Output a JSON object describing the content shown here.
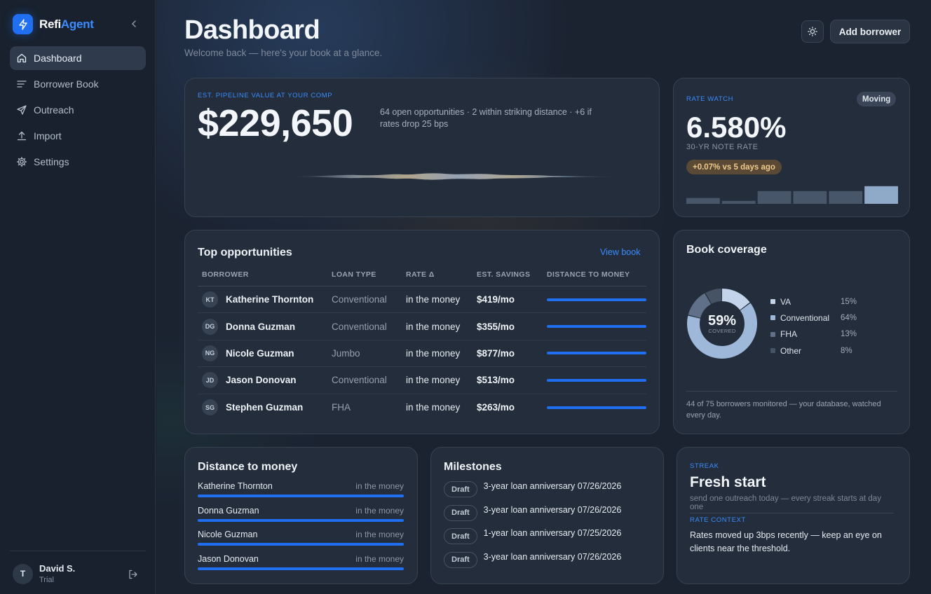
{
  "brand": {
    "name_a": "Refi",
    "name_b": "Agent"
  },
  "nav": [
    {
      "label": "Dashboard"
    },
    {
      "label": "Borrower Book"
    },
    {
      "label": "Outreach"
    },
    {
      "label": "Import"
    },
    {
      "label": "Settings"
    }
  ],
  "user": {
    "initial": "T",
    "name": "David S.",
    "plan": "Trial"
  },
  "header": {
    "title": "Dashboard",
    "subtitle": "Welcome back — here's your book at a glance.",
    "add_label": "Add borrower"
  },
  "pipeline": {
    "kicker": "EST. PIPELINE VALUE AT YOUR COMP",
    "value": "$229,650",
    "desc": "64 open opportunities · 2 within striking distance · +6 if rates drop 25 bps"
  },
  "rate_watch": {
    "kicker": "RATE WATCH",
    "badge": "Moving",
    "value": "6.580%",
    "label": "30-YR NOTE RATE",
    "change": "+0.07% vs 5 days ago",
    "history": [
      0.3,
      0.15,
      0.65,
      0.65,
      0.65,
      0.9
    ],
    "colors": {
      "bar": "#475669",
      "bar_latest": "#8fa9c9"
    }
  },
  "opportunities": {
    "title": "Top opportunities",
    "view_link": "View book",
    "columns": [
      "BORROWER",
      "LOAN TYPE",
      "RATE Δ",
      "EST. SAVINGS",
      "DISTANCE TO MONEY"
    ],
    "rows": [
      {
        "initials": "KT",
        "name": "Katherine Thornton",
        "loan": "Conventional",
        "rate": "in the money",
        "savings": "$419/mo",
        "distance": 1.0
      },
      {
        "initials": "DG",
        "name": "Donna Guzman",
        "loan": "Conventional",
        "rate": "in the money",
        "savings": "$355/mo",
        "distance": 1.0
      },
      {
        "initials": "NG",
        "name": "Nicole Guzman",
        "loan": "Jumbo",
        "rate": "in the money",
        "savings": "$877/mo",
        "distance": 1.0
      },
      {
        "initials": "JD",
        "name": "Jason Donovan",
        "loan": "Conventional",
        "rate": "in the money",
        "savings": "$513/mo",
        "distance": 1.0
      },
      {
        "initials": "SG",
        "name": "Stephen Guzman",
        "loan": "FHA",
        "rate": "in the money",
        "savings": "$263/mo",
        "distance": 1.0
      }
    ]
  },
  "coverage": {
    "title": "Book coverage",
    "center_value": "59%",
    "center_label": "COVERED",
    "segments": [
      {
        "name": "VA",
        "pct": "15%",
        "value": 15,
        "color": "#c3d4ea"
      },
      {
        "name": "Conventional",
        "pct": "64%",
        "value": 64,
        "color": "#9db8d9"
      },
      {
        "name": "FHA",
        "pct": "13%",
        "value": 13,
        "color": "#5f7088"
      },
      {
        "name": "Other",
        "pct": "8%",
        "value": 8,
        "color": "#465364"
      }
    ],
    "note": "44 of 75 borrowers monitored — your database, watched every day."
  },
  "distance": {
    "title": "Distance to money",
    "items": [
      {
        "name": "Katherine Thornton",
        "status": "in the money",
        "progress": 1.0
      },
      {
        "name": "Donna Guzman",
        "status": "in the money",
        "progress": 1.0
      },
      {
        "name": "Nicole Guzman",
        "status": "in the money",
        "progress": 1.0
      },
      {
        "name": "Jason Donovan",
        "status": "in the money",
        "progress": 1.0
      }
    ]
  },
  "milestones": {
    "title": "Milestones",
    "items": [
      {
        "badge": "Draft",
        "text": "3-year loan anniversary 07/26/2026"
      },
      {
        "badge": "Draft",
        "text": "3-year loan anniversary 07/26/2026"
      },
      {
        "badge": "Draft",
        "text": "1-year loan anniversary 07/25/2026"
      },
      {
        "badge": "Draft",
        "text": "3-year loan anniversary 07/26/2026"
      }
    ]
  },
  "streak": {
    "kicker": "STREAK",
    "title": "Fresh start",
    "sub": "send one outreach today — every streak starts at day one",
    "context_kicker": "RATE CONTEXT",
    "context": "Rates moved up 3bps recently — keep an eye on clients near the threshold."
  },
  "colors": {
    "accent": "#1f6ff0",
    "link": "#3b8cff"
  }
}
